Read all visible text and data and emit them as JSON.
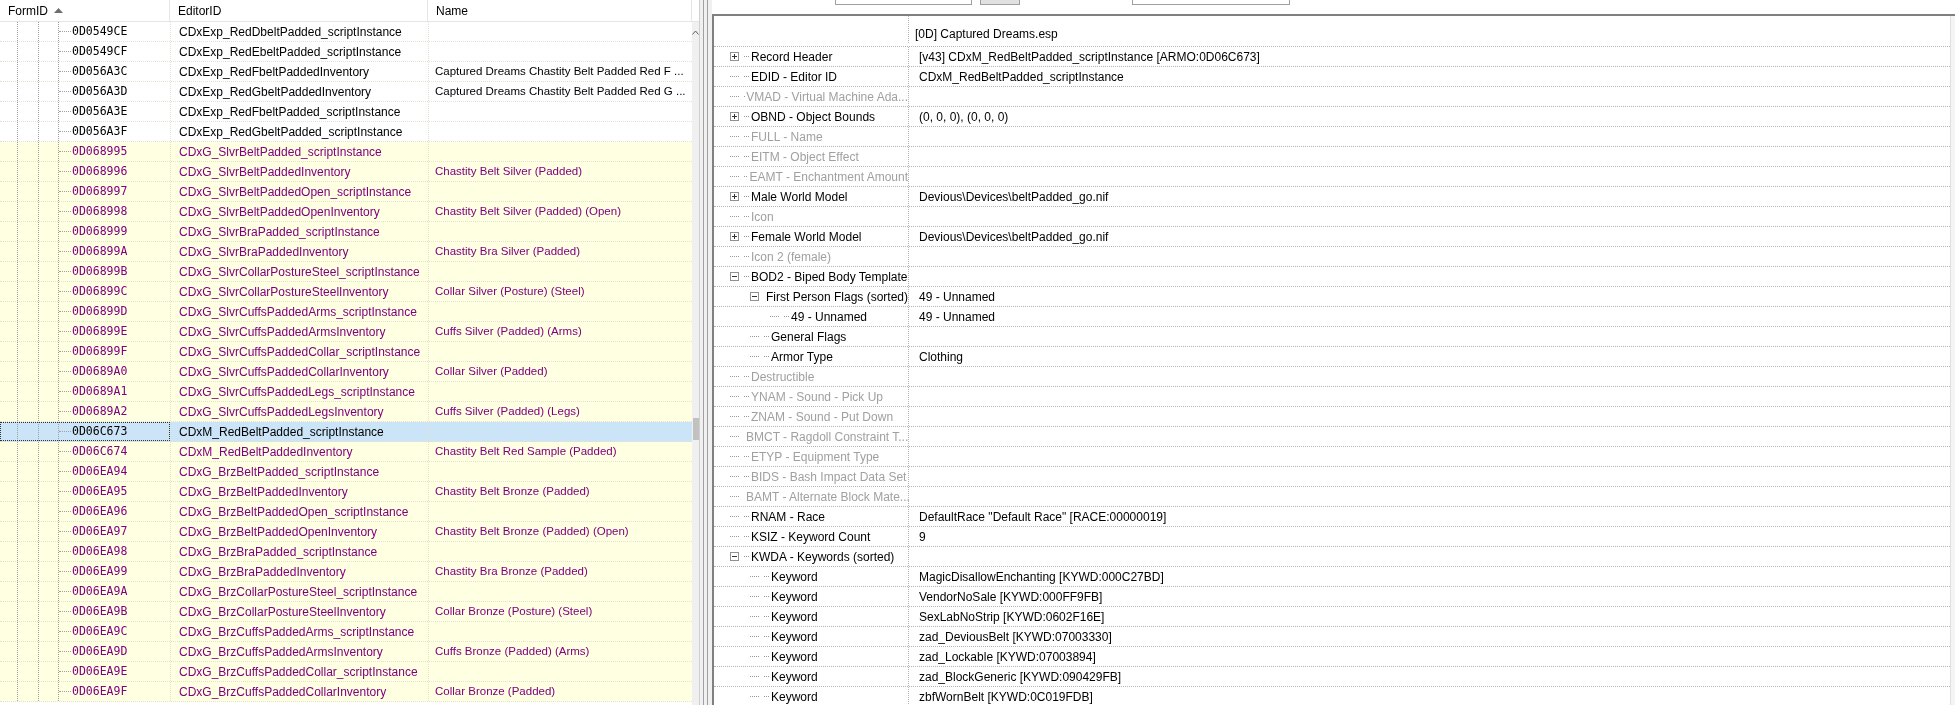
{
  "list": {
    "columns": [
      {
        "label": "FormID",
        "sorted": true
      },
      {
        "label": "EditorID",
        "sorted": false
      },
      {
        "label": "Name",
        "sorted": false
      }
    ],
    "rows": [
      {
        "form_id": "0D0549CE",
        "editor_id": "CDxExp_RedDbeltPadded_scriptInstance",
        "highlighted": false,
        "selected": false
      },
      {
        "form_id": "0D0549CF",
        "editor_id": "CDxExp_RedEbeltPadded_scriptInstance",
        "highlighted": false,
        "selected": false
      },
      {
        "form_id": "0D056A3C",
        "editor_id": "CDxExp_RedFbeltPaddedInventory",
        "name": "Captured Dreams Chastity Belt Padded Red F ...",
        "highlighted": false,
        "selected": false
      },
      {
        "form_id": "0D056A3D",
        "editor_id": "CDxExp_RedGbeltPaddedInventory",
        "name": "Captured Dreams Chastity Belt Padded Red G ...",
        "highlighted": false,
        "selected": false
      },
      {
        "form_id": "0D056A3E",
        "editor_id": "CDxExp_RedFbeltPadded_scriptInstance",
        "highlighted": false,
        "selected": false
      },
      {
        "form_id": "0D056A3F",
        "editor_id": "CDxExp_RedGbeltPadded_scriptInstance",
        "highlighted": false,
        "selected": false
      },
      {
        "form_id": "0D068995",
        "editor_id": "CDxG_SlvrBeltPadded_scriptInstance",
        "highlighted": true,
        "selected": false
      },
      {
        "form_id": "0D068996",
        "editor_id": "CDxG_SlvrBeltPaddedInventory",
        "name": "Chastity Belt Silver (Padded)",
        "highlighted": true,
        "selected": false
      },
      {
        "form_id": "0D068997",
        "editor_id": "CDxG_SlvrBeltPaddedOpen_scriptInstance",
        "highlighted": true,
        "selected": false
      },
      {
        "form_id": "0D068998",
        "editor_id": "CDxG_SlvrBeltPaddedOpenInventory",
        "name": "Chastity Belt Silver (Padded) (Open)",
        "highlighted": true,
        "selected": false
      },
      {
        "form_id": "0D068999",
        "editor_id": "CDxG_SlvrBraPadded_scriptInstance",
        "highlighted": true,
        "selected": false
      },
      {
        "form_id": "0D06899A",
        "editor_id": "CDxG_SlvrBraPaddedInventory",
        "name": "Chastity Bra Silver (Padded)",
        "highlighted": true,
        "selected": false
      },
      {
        "form_id": "0D06899B",
        "editor_id": "CDxG_SlvrCollarPostureSteel_scriptInstance",
        "highlighted": true,
        "selected": false
      },
      {
        "form_id": "0D06899C",
        "editor_id": "CDxG_SlvrCollarPostureSteelInventory",
        "name": "Collar Silver (Posture) (Steel)",
        "highlighted": true,
        "selected": false
      },
      {
        "form_id": "0D06899D",
        "editor_id": "CDxG_SlvrCuffsPaddedArms_scriptInstance",
        "highlighted": true,
        "selected": false
      },
      {
        "form_id": "0D06899E",
        "editor_id": "CDxG_SlvrCuffsPaddedArmsInventory",
        "name": "Cuffs Silver (Padded) (Arms)",
        "highlighted": true,
        "selected": false
      },
      {
        "form_id": "0D06899F",
        "editor_id": "CDxG_SlvrCuffsPaddedCollar_scriptInstance",
        "highlighted": true,
        "selected": false
      },
      {
        "form_id": "0D0689A0",
        "editor_id": "CDxG_SlvrCuffsPaddedCollarInventory",
        "name": "Collar Silver (Padded)",
        "highlighted": true,
        "selected": false
      },
      {
        "form_id": "0D0689A1",
        "editor_id": "CDxG_SlvrCuffsPaddedLegs_scriptInstance",
        "highlighted": true,
        "selected": false
      },
      {
        "form_id": "0D0689A2",
        "editor_id": "CDxG_SlvrCuffsPaddedLegsInventory",
        "name": "Cuffs Silver (Padded) (Legs)",
        "highlighted": true,
        "selected": false
      },
      {
        "form_id": "0D06C673",
        "editor_id": "CDxM_RedBeltPadded_scriptInstance",
        "highlighted": false,
        "selected": true
      },
      {
        "form_id": "0D06C674",
        "editor_id": "CDxM_RedBeltPaddedInventory",
        "name": "Chastity Belt Red Sample (Padded)",
        "highlighted": true,
        "selected": false
      },
      {
        "form_id": "0D06EA94",
        "editor_id": "CDxG_BrzBeltPadded_scriptInstance",
        "highlighted": true,
        "selected": false
      },
      {
        "form_id": "0D06EA95",
        "editor_id": "CDxG_BrzBeltPaddedInventory",
        "name": "Chastity Belt Bronze (Padded)",
        "highlighted": true,
        "selected": false
      },
      {
        "form_id": "0D06EA96",
        "editor_id": "CDxG_BrzBeltPaddedOpen_scriptInstance",
        "highlighted": true,
        "selected": false
      },
      {
        "form_id": "0D06EA97",
        "editor_id": "CDxG_BrzBeltPaddedOpenInventory",
        "name": "Chastity Belt Bronze (Padded) (Open)",
        "highlighted": true,
        "selected": false
      },
      {
        "form_id": "0D06EA98",
        "editor_id": "CDxG_BrzBraPadded_scriptInstance",
        "highlighted": true,
        "selected": false
      },
      {
        "form_id": "0D06EA99",
        "editor_id": "CDxG_BrzBraPaddedInventory",
        "name": "Chastity Bra Bronze (Padded)",
        "highlighted": true,
        "selected": false
      },
      {
        "form_id": "0D06EA9A",
        "editor_id": "CDxG_BrzCollarPostureSteel_scriptInstance",
        "highlighted": true,
        "selected": false
      },
      {
        "form_id": "0D06EA9B",
        "editor_id": "CDxG_BrzCollarPostureSteelInventory",
        "name": "Collar Bronze (Posture) (Steel)",
        "highlighted": true,
        "selected": false
      },
      {
        "form_id": "0D06EA9C",
        "editor_id": "CDxG_BrzCuffsPaddedArms_scriptInstance",
        "highlighted": true,
        "selected": false
      },
      {
        "form_id": "0D06EA9D",
        "editor_id": "CDxG_BrzCuffsPaddedArmsInventory",
        "name": "Cuffs Bronze (Padded) (Arms)",
        "highlighted": true,
        "selected": false
      },
      {
        "form_id": "0D06EA9E",
        "editor_id": "CDxG_BrzCuffsPaddedCollar_scriptInstance",
        "highlighted": true,
        "selected": false
      },
      {
        "form_id": "0D06EA9F",
        "editor_id": "CDxG_BrzCuffsPaddedCollarInventory",
        "name": "Collar Bronze (Padded)",
        "highlighted": true,
        "selected": false
      }
    ]
  },
  "record": {
    "file": "[0D] Captured Dreams.esp",
    "rows": [
      {
        "label": "Record Header",
        "value": "[v43] CDxM_RedBeltPadded_scriptInstance [ARMO:0D06C673]",
        "disabled": false,
        "expanded": false
      },
      {
        "label": "EDID - Editor ID",
        "value": "CDxM_RedBeltPadded_scriptInstance",
        "disabled": false
      },
      {
        "label": "VMAD - Virtual Machine Ada...",
        "disabled": true
      },
      {
        "label": "OBND - Object Bounds",
        "value": "(0, 0, 0), (0, 0, 0)",
        "disabled": false,
        "expanded": false
      },
      {
        "label": "FULL - Name",
        "disabled": true
      },
      {
        "label": "EITM - Object Effect",
        "disabled": true
      },
      {
        "label": "EAMT - Enchantment Amount",
        "disabled": true
      },
      {
        "label": "Male World Model",
        "value": "Devious\\Devices\\beltPadded_go.nif",
        "disabled": false,
        "expanded": false
      },
      {
        "label": "Icon",
        "disabled": true
      },
      {
        "label": "Female World Model",
        "value": "Devious\\Devices\\beltPadded_go.nif",
        "disabled": false,
        "expanded": false
      },
      {
        "label": "Icon 2 (female)",
        "disabled": true
      },
      {
        "label": "BOD2 - Biped Body Template",
        "disabled": false,
        "expanded": true,
        "children": [
          {
            "label": "First Person Flags (sorted)",
            "value": "49 - Unnamed",
            "disabled": false,
            "expanded": true,
            "children": [
              {
                "label": "49 - Unnamed",
                "value": "49 - Unnamed",
                "disabled": false
              }
            ]
          },
          {
            "label": "General Flags",
            "disabled": false
          },
          {
            "label": "Armor Type",
            "value": "Clothing",
            "disabled": false
          }
        ]
      },
      {
        "label": "Destructible",
        "disabled": true
      },
      {
        "label": "YNAM - Sound - Pick Up",
        "disabled": true
      },
      {
        "label": "ZNAM - Sound - Put Down",
        "disabled": true
      },
      {
        "label": "BMCT - Ragdoll Constraint T...",
        "disabled": true
      },
      {
        "label": "ETYP - Equipment Type",
        "disabled": true
      },
      {
        "label": "BIDS - Bash Impact Data Set",
        "disabled": true
      },
      {
        "label": "BAMT - Alternate Block Mate...",
        "disabled": true
      },
      {
        "label": "RNAM - Race",
        "value": "DefaultRace \"Default Race\" [RACE:00000019]",
        "disabled": false
      },
      {
        "label": "KSIZ - Keyword Count",
        "value": "9",
        "disabled": false
      },
      {
        "label": "KWDA - Keywords (sorted)",
        "disabled": false,
        "expanded": true,
        "children": [
          {
            "label": "Keyword",
            "value": "MagicDisallowEnchanting [KYWD:000C27BD]",
            "disabled": false
          },
          {
            "label": "Keyword",
            "value": "VendorNoSale [KYWD:000FF9FB]",
            "disabled": false
          },
          {
            "label": "Keyword",
            "value": "SexLabNoStrip [KYWD:0602F16E]",
            "disabled": false
          },
          {
            "label": "Keyword",
            "value": "zad_DeviousBelt [KYWD:07003330]",
            "disabled": false
          },
          {
            "label": "Keyword",
            "value": "zad_Lockable [KYWD:07003894]",
            "disabled": false
          },
          {
            "label": "Keyword",
            "value": "zad_BlockGeneric [KYWD:090429FB]",
            "disabled": false
          },
          {
            "label": "Keyword",
            "value": "zbfWornBelt [KYWD:0C019FDB]",
            "disabled": false
          }
        ]
      }
    ]
  }
}
